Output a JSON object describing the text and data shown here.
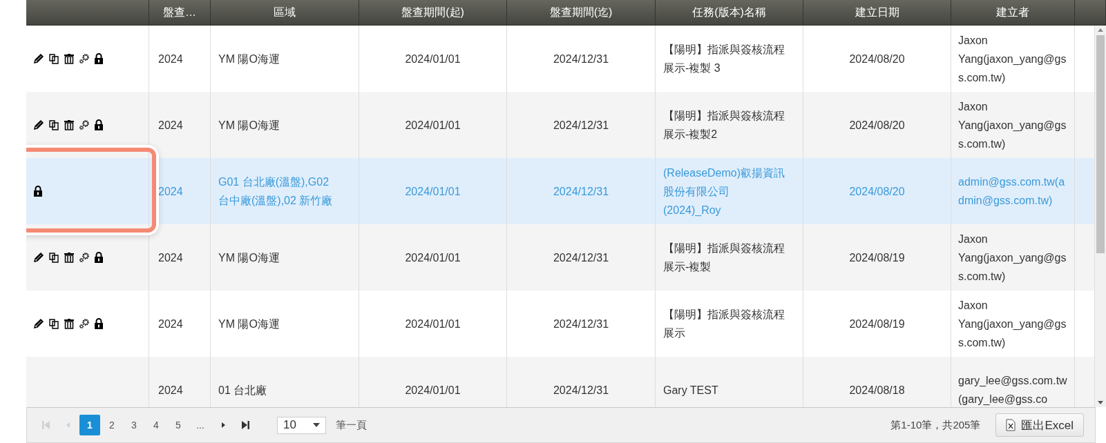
{
  "table": {
    "columns": [
      "盤查…",
      "區域",
      "盤查期間(起)",
      "盤查期間(迄)",
      "任務(版本)名稱",
      "建立日期",
      "建立者"
    ],
    "rows": [
      {
        "actions": [
          {
            "kind": "edit"
          },
          {
            "kind": "copy"
          },
          {
            "kind": "delete"
          },
          {
            "kind": "settings"
          },
          {
            "kind": "lock"
          }
        ],
        "selected": false,
        "highlighted": false,
        "cells": [
          "2024",
          "YM 陽O海運",
          "2024/01/01",
          "2024/12/31",
          "【陽明】指派與簽核流程展示-複製 3",
          "2024/08/20",
          "Jaxon Yang(jaxon_yang@gss.com.tw)"
        ]
      },
      {
        "actions": [
          {
            "kind": "edit"
          },
          {
            "kind": "copy"
          },
          {
            "kind": "delete"
          },
          {
            "kind": "settings"
          },
          {
            "kind": "lock"
          }
        ],
        "selected": false,
        "highlighted": false,
        "cells": [
          "2024",
          "YM 陽O海運",
          "2024/01/01",
          "2024/12/31",
          "【陽明】指派與簽核流程展示-複製2",
          "2024/08/20",
          "Jaxon Yang(jaxon_yang@gss.com.tw)"
        ]
      },
      {
        "actions": [
          {
            "kind": "lock"
          }
        ],
        "selected": true,
        "highlighted": true,
        "cells": [
          "2024",
          "G01 台北廠(溫盤),G02 台中廠(溫盤),02 新竹廠",
          "2024/01/01",
          "2024/12/31",
          "(ReleaseDemo)叡揚資訊股份有限公司(2024)_Roy",
          "2024/08/20",
          "admin@gss.com.tw(admin@gss.com.tw)"
        ]
      },
      {
        "actions": [
          {
            "kind": "edit"
          },
          {
            "kind": "copy"
          },
          {
            "kind": "delete"
          },
          {
            "kind": "settings"
          },
          {
            "kind": "lock"
          }
        ],
        "selected": false,
        "highlighted": false,
        "cells": [
          "2024",
          "YM 陽O海運",
          "2024/01/01",
          "2024/12/31",
          "【陽明】指派與簽核流程展示-複製",
          "2024/08/19",
          "Jaxon Yang(jaxon_yang@gss.com.tw)"
        ]
      },
      {
        "actions": [
          {
            "kind": "edit"
          },
          {
            "kind": "copy"
          },
          {
            "kind": "delete"
          },
          {
            "kind": "settings"
          },
          {
            "kind": "lock"
          }
        ],
        "selected": false,
        "highlighted": false,
        "cells": [
          "2024",
          "YM 陽O海運",
          "2024/01/01",
          "2024/12/31",
          "【陽明】指派與簽核流程展示",
          "2024/08/19",
          "Jaxon Yang(jaxon_yang@gss.com.tw)"
        ]
      },
      {
        "selected": false,
        "highlighted": false,
        "cells": [
          "2024",
          "01 台北廠",
          "2024/01/01",
          "2024/12/31",
          "Gary TEST",
          "2024/08/18",
          "gary_lee@gss.com.tw(gary_lee@gss.co"
        ]
      }
    ]
  },
  "pager": {
    "nav_before": [
      {
        "kind": "first",
        "disabled": true
      },
      {
        "kind": "prev",
        "disabled": true
      }
    ],
    "pages": [
      {
        "label": "1",
        "selected": true
      },
      {
        "label": "2",
        "selected": false
      },
      {
        "label": "3",
        "selected": false
      },
      {
        "label": "4",
        "selected": false
      },
      {
        "label": "5",
        "selected": false
      },
      {
        "label": "...",
        "selected": false
      }
    ],
    "nav_after": [
      {
        "kind": "next",
        "disabled": false
      },
      {
        "kind": "last",
        "disabled": false
      }
    ],
    "page_size": "10",
    "page_size_label": "筆一頁",
    "summary": "第1-10筆，共205筆",
    "export_button": "匯出Excel"
  }
}
